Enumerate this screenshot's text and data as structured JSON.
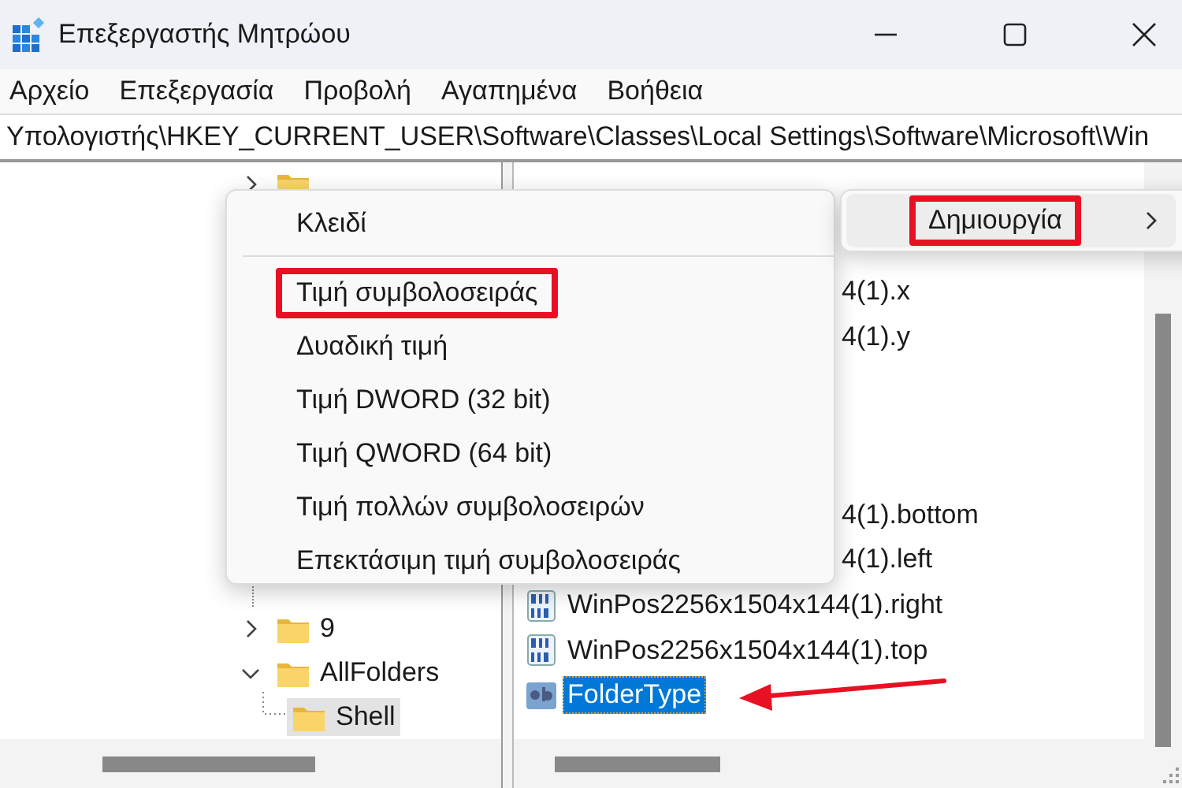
{
  "window": {
    "title": "Επεξεργαστής Μητρώου"
  },
  "menu_bar": [
    {
      "label": "Αρχείο"
    },
    {
      "label": "Επεξεργασία"
    },
    {
      "label": "Προβολή"
    },
    {
      "label": "Αγαπημένα"
    },
    {
      "label": "Βοήθεια"
    }
  ],
  "address": "Υπολογιστής\\HKEY_CURRENT_USER\\Software\\Classes\\Local Settings\\Software\\Microsoft\\Win",
  "tree": [
    {
      "expanded": false,
      "selected": false
    },
    {
      "label": "9",
      "expanded": false,
      "selected": false
    },
    {
      "label": "AllFolders",
      "expanded": true,
      "selected": false,
      "children": [
        {
          "label": "Shell",
          "selected": true
        }
      ]
    }
  ],
  "values": [
    {
      "name": "4(1).x",
      "kind": "covered",
      "selected": false
    },
    {
      "name": "4(1).y",
      "kind": "covered",
      "selected": false
    },
    {
      "name": "4(1).bottom",
      "kind": "covered",
      "selected": false
    },
    {
      "name": "4(1).left",
      "kind": "covered",
      "selected": false
    },
    {
      "name": "WinPos2256x1504x144(1).right",
      "kind": "binary",
      "selected": false
    },
    {
      "name": "WinPos2256x1504x144(1).top",
      "kind": "binary",
      "selected": false
    },
    {
      "name": "FolderType",
      "kind": "string",
      "selected": true,
      "pointed_at": true
    }
  ],
  "parent_menu": {
    "items": [
      {
        "label": "Δημιουργία",
        "has_submenu": true,
        "highlighted": true
      }
    ]
  },
  "context_menu": {
    "items": [
      {
        "kind": "item",
        "label": "Κλειδί",
        "highlighted": false
      },
      {
        "kind": "separator"
      },
      {
        "kind": "item",
        "label": "Τιμή συμβολοσειράς",
        "highlighted": true
      },
      {
        "kind": "item",
        "label": "Δυαδική τιμή",
        "highlighted": false
      },
      {
        "kind": "item",
        "label": "Τιμή DWORD (32 bit)",
        "highlighted": false
      },
      {
        "kind": "item",
        "label": "Τιμή QWORD (64 bit)",
        "highlighted": false
      },
      {
        "kind": "item",
        "label": "Τιμή πολλών συμβολοσειρών",
        "highlighted": false
      },
      {
        "kind": "item",
        "label": "Επεκτάσιμη τιμή συμβολοσειράς",
        "highlighted": false
      }
    ]
  }
}
